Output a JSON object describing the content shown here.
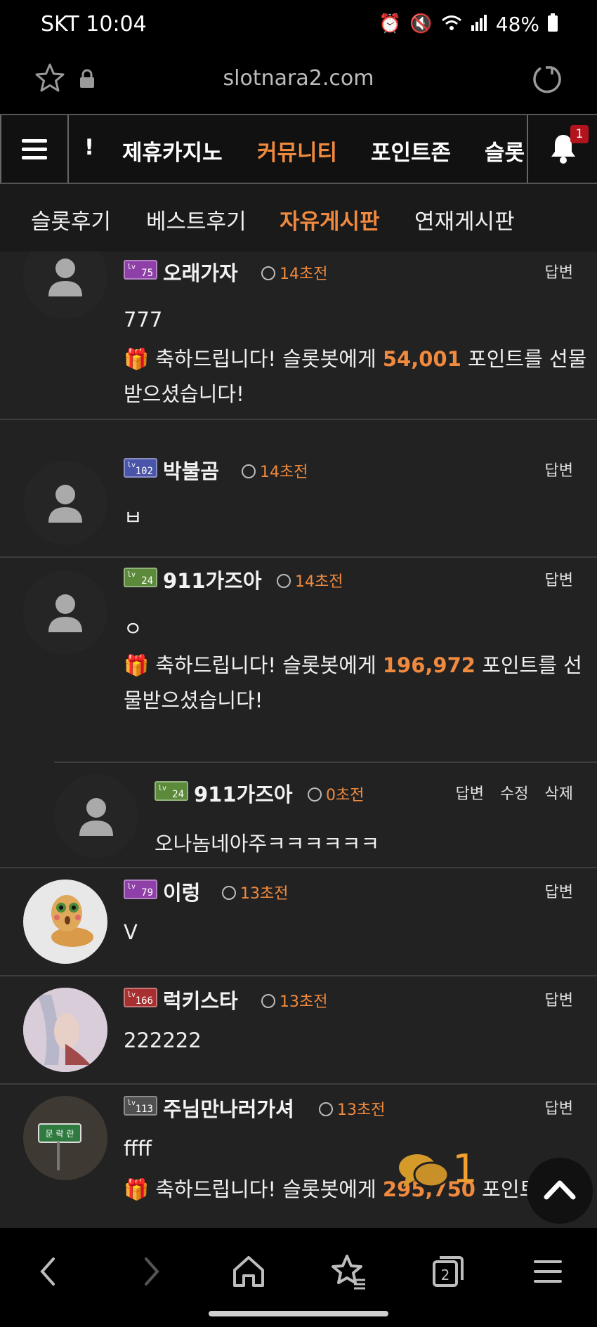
{
  "status_bar": {
    "carrier": "SKT",
    "time": "10:04",
    "battery": "48%"
  },
  "browser": {
    "url": "slotnara2.com"
  },
  "main_nav": {
    "items": [
      "!",
      "제휴카지노",
      "커뮤니티",
      "포인트존",
      "슬롯"
    ],
    "active": "커뮤니티",
    "notification_count": "1"
  },
  "sub_tabs": {
    "items": [
      "슬롯후기",
      "베스트후기",
      "자유게시판",
      "연재게시판"
    ],
    "active": "자유게시판"
  },
  "comments": [
    {
      "level": "75",
      "level_color": "#8e3fa8",
      "nick": "오래가자",
      "time": "14초전",
      "actions": [
        "답변"
      ],
      "text": "777",
      "gift_prefix": "축하드립니다! 슬롯봇에게 ",
      "gift_points": "54,001",
      "gift_suffix": " 포인트를 선물받으셨습니다!",
      "avatar": "default"
    },
    {
      "level": "102",
      "level_color": "#4a54a8",
      "nick": "박불곰",
      "time": "14초전",
      "actions": [
        "답변"
      ],
      "text": "ㅂ",
      "avatar": "default"
    },
    {
      "level": "24",
      "level_color": "#5a8a3a",
      "nick": "911가즈아",
      "time": "14초전",
      "actions": [
        "답변"
      ],
      "text": "ㅇ",
      "gift_prefix": "축하드립니다! 슬롯봇에게 ",
      "gift_points": "196,972",
      "gift_suffix": " 포인트를 선물받으셨습니다!",
      "avatar": "default"
    },
    {
      "level": "24",
      "level_color": "#5a8a3a",
      "nick": "911가즈아",
      "time": "0초전",
      "actions": [
        "답변",
        "수정",
        "삭제"
      ],
      "text": "오나놈네아주ㅋㅋㅋㅋㅋㅋ",
      "avatar": "default",
      "reply": true
    },
    {
      "level": "79",
      "level_color": "#8e3fa8",
      "nick": "이렁",
      "time": "13초전",
      "actions": [
        "답변"
      ],
      "text": "V",
      "avatar": "worm"
    },
    {
      "level": "166",
      "level_color": "#a82f2f",
      "nick": "럭키스타",
      "time": "13초전",
      "actions": [
        "답변"
      ],
      "text": "222222",
      "avatar": "anime"
    },
    {
      "level": "113",
      "level_color": "#505050",
      "nick": "주님만나러가셔",
      "time": "13초전",
      "actions": [
        "답변"
      ],
      "text": "ffff",
      "gift_prefix": "축하드립니다! 슬롯봇에게 ",
      "gift_points": "295,750",
      "gift_suffix": " 포인트를 선",
      "avatar": "sign"
    }
  ],
  "floating": {
    "chat_count": "1"
  },
  "icons": {
    "star": "star-icon",
    "lock": "lock-icon",
    "reload": "reload-icon",
    "bell": "bell-icon",
    "clock": "clock-icon",
    "gift": "gift-icon",
    "chat": "chat-bubbles-icon",
    "back": "chevron-left-icon",
    "forward": "chevron-right-icon",
    "home": "home-icon",
    "bookmarks": "bookmark-star-icon",
    "tabs": "tabs-icon",
    "menu": "menu-icon"
  },
  "colors": {
    "accent": "#f08a3e",
    "background": "#222222",
    "badge": "#b3131d"
  }
}
